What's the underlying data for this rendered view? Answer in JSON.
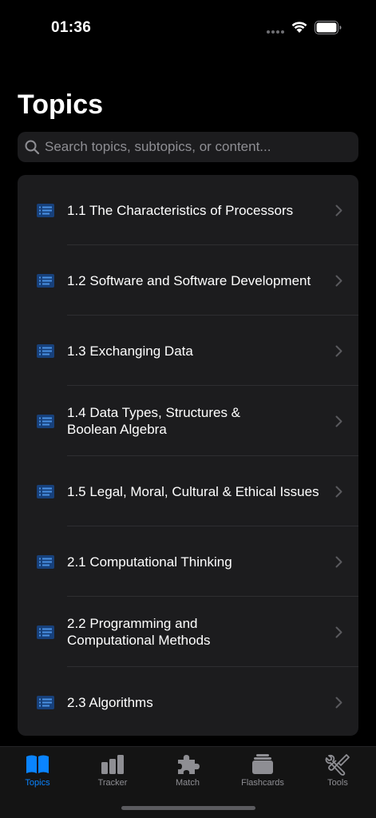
{
  "status_bar": {
    "time": "01:36"
  },
  "page": {
    "title": "Topics"
  },
  "search": {
    "placeholder": "Search topics, subtopics, or content..."
  },
  "topics": [
    {
      "label": "1.1 The Characteristics of Processors"
    },
    {
      "label": "1.2 Software and Software Development"
    },
    {
      "label": "1.3 Exchanging Data"
    },
    {
      "label": "1.4 Data Types, Structures &\nBoolean Algebra"
    },
    {
      "label": "1.5 Legal, Moral, Cultural & Ethical Issues"
    },
    {
      "label": "2.1 Computational Thinking"
    },
    {
      "label": "2.2 Programming and\nComputational Methods"
    },
    {
      "label": "2.3 Algorithms"
    }
  ],
  "tabs": [
    {
      "label": "Topics",
      "icon": "book-icon",
      "active": true
    },
    {
      "label": "Tracker",
      "icon": "bar-chart-icon",
      "active": false
    },
    {
      "label": "Match",
      "icon": "puzzle-icon",
      "active": false
    },
    {
      "label": "Flashcards",
      "icon": "card-stack-icon",
      "active": false
    },
    {
      "label": "Tools",
      "icon": "wrench-screwdriver-icon",
      "active": false
    }
  ],
  "colors": {
    "accent": "#0a84ff",
    "background": "#000000",
    "surface": "#1c1c1e",
    "inactive": "#8e8e93"
  }
}
